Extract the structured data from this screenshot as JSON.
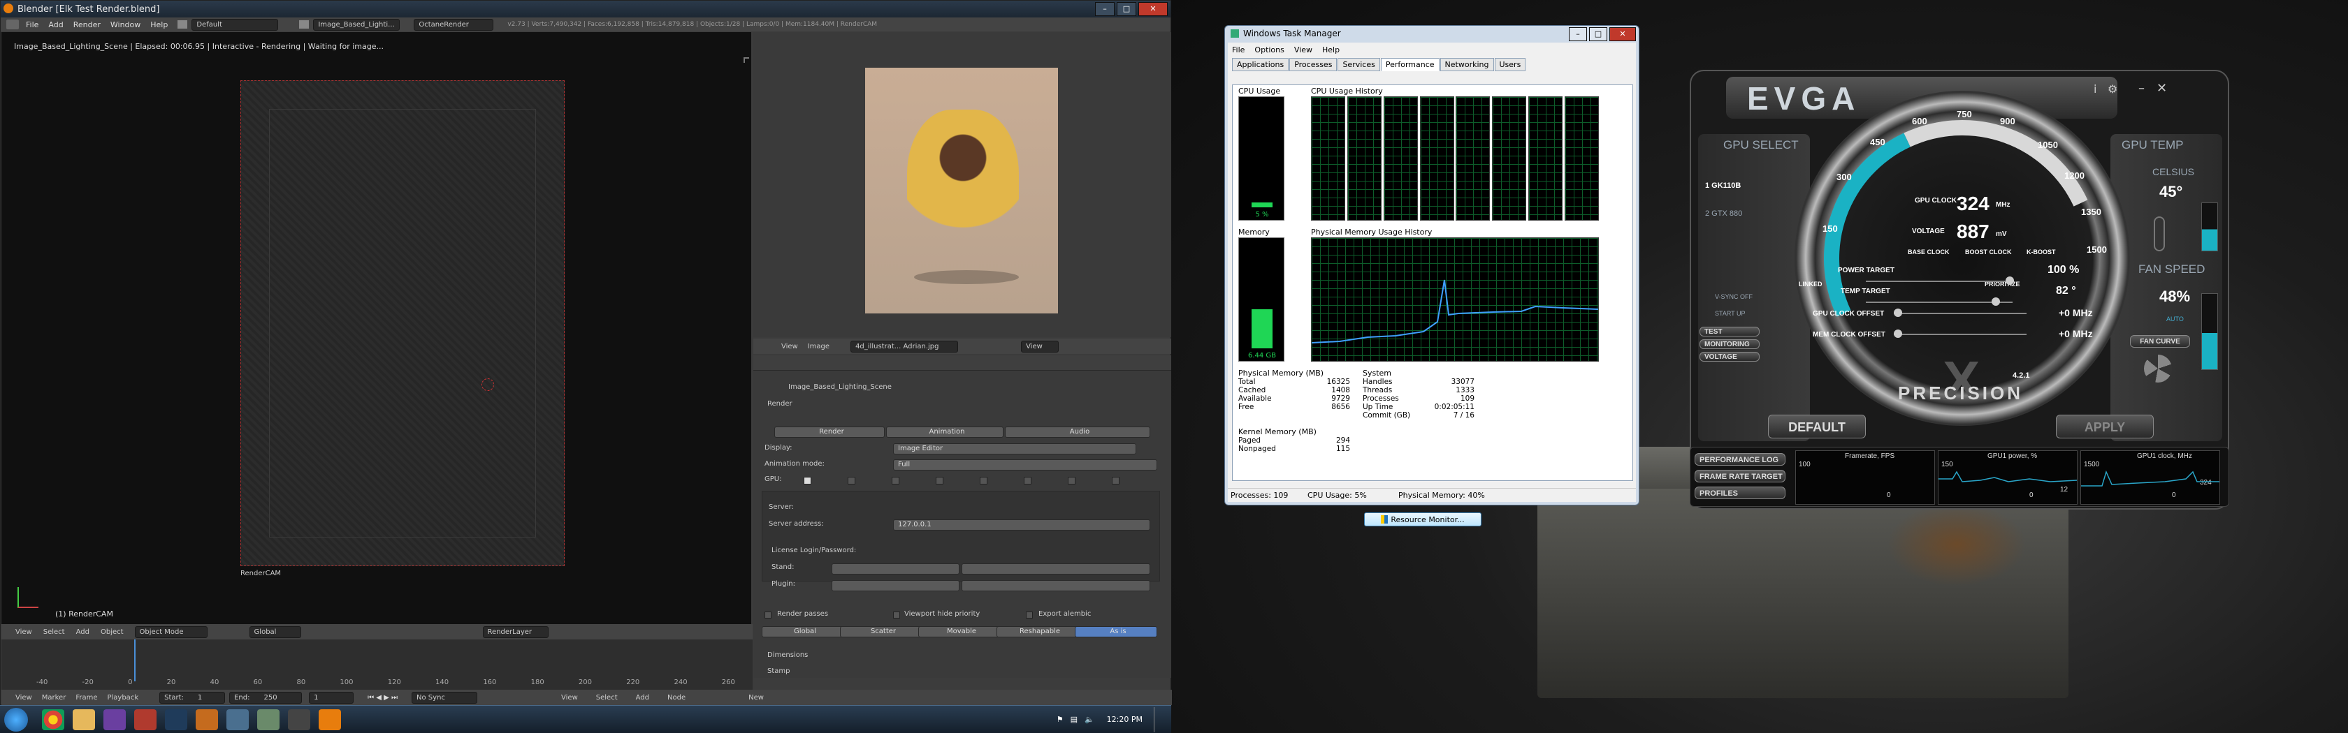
{
  "blender": {
    "title": "Blender [Elk Test Render.blend]",
    "menu": [
      "File",
      "Add",
      "Render",
      "Window",
      "Help"
    ],
    "layout_field": "Default",
    "scene_field": "Image_Based_Lighti...",
    "engine": "OctaneRender",
    "status": "v2.73 | Verts:7,490,342 | Faces:6,192,858 | Tris:14,879,818 | Objects:1/28 | Lamps:0/0 | Mem:1184.40M | RenderCAM",
    "viewport_status": "Image_Based_Lighting_Scene | Elapsed: 00:06.95 | Interactive - Rendering | Waiting for image...",
    "camera_label": "RenderCAM",
    "object_label": "(1) RenderCAM",
    "viewport_menu": [
      "View",
      "Select",
      "Add",
      "Object"
    ],
    "mode": "Object Mode",
    "orientation": "Global",
    "render_layer": "RenderLayer",
    "image_menu": [
      "View",
      "Image"
    ],
    "image_name": "4d_illustrat... Adrian.jpg",
    "image_view": "View",
    "props": {
      "scene_name": "Image_Based_Lighting_Scene",
      "section": "Render",
      "render_btn": "Render",
      "animation_btn": "Animation",
      "audio_btn": "Audio",
      "display_label": "Display:",
      "display_value": "Image Editor",
      "anim_mode_label": "Animation mode:",
      "anim_mode_value": "Full",
      "gpu_label": "GPU:",
      "server_label": "Server:",
      "server_addr_label": "Server address:",
      "server_addr_value": "127.0.0.1",
      "license_label": "License Login/Password:",
      "stand_label": "Stand:",
      "plugin_label": "Plugin:",
      "render_passes": "Render passes",
      "viewport_hide": "Viewport hide priority",
      "export_alembic": "Export alembic",
      "tabs": [
        "Global",
        "Scatter",
        "Movable",
        "Reshapable",
        "As is"
      ],
      "dimensions": "Dimensions",
      "stamp": "Stamp"
    },
    "timeline": {
      "ticks": [
        "-40",
        "-20",
        "0",
        "20",
        "40",
        "60",
        "80",
        "100",
        "120",
        "140",
        "160",
        "180",
        "200",
        "220",
        "240",
        "260"
      ],
      "menu": [
        "View",
        "Marker",
        "Frame",
        "Playback"
      ],
      "start_label": "Start:",
      "start_value": "1",
      "end_label": "End:",
      "end_value": "250",
      "frame_value": "1",
      "sync": "No Sync"
    },
    "node_menu": [
      "View",
      "Select",
      "Add",
      "Node"
    ],
    "node_new": "New"
  },
  "taskbar": {
    "clock": "12:20 PM"
  },
  "taskmgr": {
    "title": "Windows Task Manager",
    "menu": [
      "File",
      "Options",
      "View",
      "Help"
    ],
    "tabs": [
      "Applications",
      "Processes",
      "Services",
      "Performance",
      "Networking",
      "Users"
    ],
    "active_tab": "Performance",
    "cpu_usage_label": "CPU Usage",
    "cpu_usage_value": "5 %",
    "cpu_usage_pct": 5,
    "cpu_history_label": "CPU Usage History",
    "memory_label": "Memory",
    "memory_value": "6.44 GB",
    "memory_pct": 40,
    "mem_history_label": "Physical Memory Usage History",
    "physical_memory": {
      "heading": "Physical Memory (MB)",
      "rows": [
        [
          "Total",
          "16325"
        ],
        [
          "Cached",
          "1408"
        ],
        [
          "Available",
          "9729"
        ],
        [
          "Free",
          "8656"
        ]
      ]
    },
    "system": {
      "heading": "System",
      "rows": [
        [
          "Handles",
          "33077"
        ],
        [
          "Threads",
          "1333"
        ],
        [
          "Processes",
          "109"
        ],
        [
          "Up Time",
          "0:02:05:11"
        ],
        [
          "Commit (GB)",
          "7 / 16"
        ]
      ]
    },
    "kernel_memory": {
      "heading": "Kernel Memory (MB)",
      "rows": [
        [
          "Paged",
          "294"
        ],
        [
          "Nonpaged",
          "115"
        ]
      ]
    },
    "resource_button": "Resource Monitor...",
    "status": [
      "Processes: 109",
      "CPU Usage: 5%",
      "Physical Memory: 40%"
    ]
  },
  "evga": {
    "brand": "EVGA",
    "gpu_select": "GPU SELECT",
    "gpu1": "1 GK110B",
    "gpu2": "2 GTX 880",
    "gpu_temp": "GPU TEMP",
    "celsius": "CELSIUS",
    "temp_value": "45°",
    "fan_speed": "FAN SPEED",
    "fan_value": "48%",
    "fan_auto": "AUTO",
    "fan_curve": "FAN CURVE",
    "gpu_clock_label": "GPU CLOCK",
    "gpu_clock_value": "324",
    "gpu_clock_unit": "MHz",
    "voltage_label": "VOLTAGE",
    "voltage_value": "887",
    "voltage_unit": "mV",
    "base_clock": "BASE CLOCK",
    "boost_clock": "BOOST CLOCK",
    "linked": "LINKED",
    "prioritize": "PRIORITIZE",
    "k_boost": "K-BOOST",
    "vsync": "V-SYNC OFF",
    "start_up": "START UP",
    "test_btn": "TEST",
    "monitoring_btn": "MONITORING",
    "voltage_btn": "VOLTAGE",
    "sliders": [
      {
        "label": "POWER TARGET",
        "value": "100 %",
        "level": 1.0
      },
      {
        "label": "TEMP TARGET",
        "value": "82 °",
        "level": 0.9
      },
      {
        "label": "GPU CLOCK OFFSET",
        "value": "+0 MHz",
        "level": 0.0
      },
      {
        "label": "MEM CLOCK OFFSET",
        "value": "+0 MHz",
        "level": 0.0
      }
    ],
    "gauge_ticks": [
      "150",
      "300",
      "450",
      "600",
      "750",
      "900",
      "1050",
      "1200",
      "1350",
      "1500"
    ],
    "version": "4.2.1",
    "precision": "PRECISION",
    "x_logo": "X",
    "default_btn": "DEFAULT",
    "apply_btn": "APPLY",
    "side_buttons": [
      "PERFORMANCE LOG",
      "FRAME RATE TARGET",
      "PROFILES"
    ],
    "monitor": [
      {
        "title": "Framerate, FPS",
        "max": "100",
        "min": "0",
        "value": ""
      },
      {
        "title": "GPU1 power, %",
        "max": "150",
        "min": "0",
        "value": "12"
      },
      {
        "title": "GPU1 clock, MHz",
        "max": "1500",
        "min": "0",
        "value": "324"
      }
    ]
  }
}
